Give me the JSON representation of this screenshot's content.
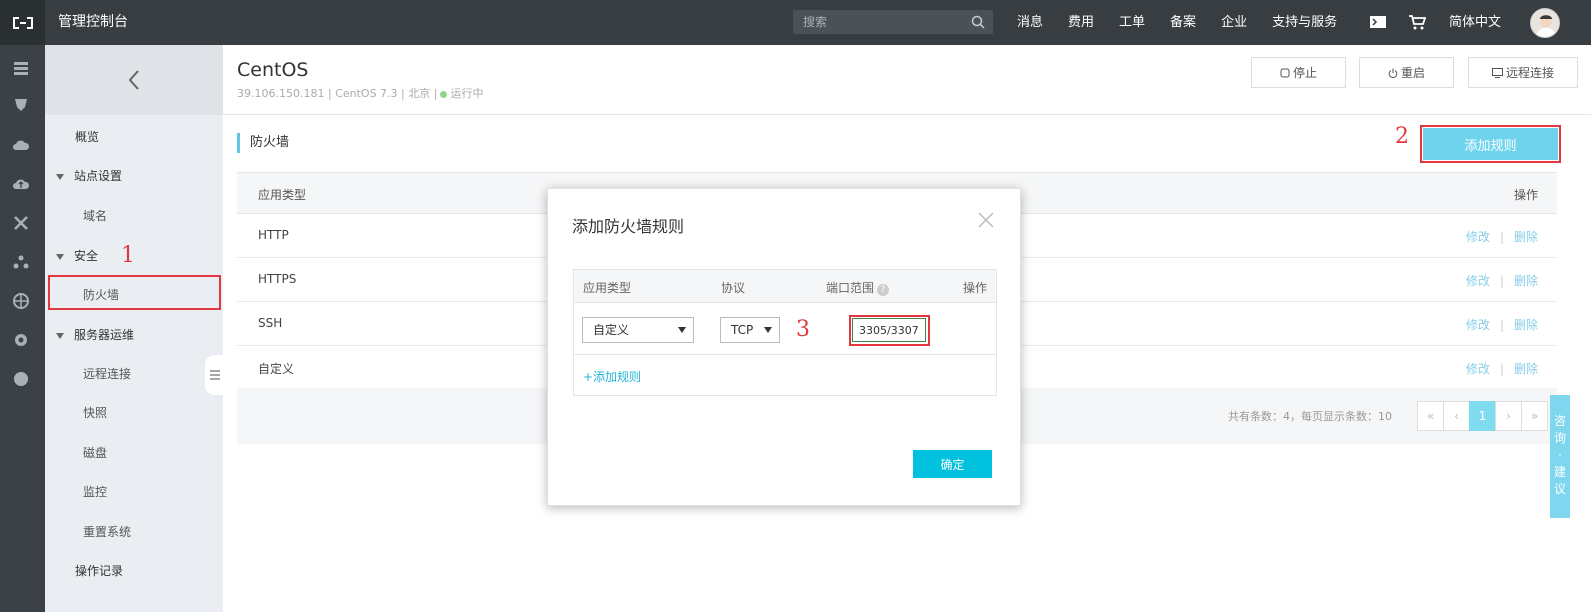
{
  "topbar": {
    "title": "管理控制台",
    "search_placeholder": "搜索",
    "nav": [
      "消息",
      "费用",
      "工单",
      "备案",
      "企业",
      "支持与服务"
    ],
    "lang": "简体中文"
  },
  "sidebar": {
    "items": [
      {
        "label": "概览"
      },
      {
        "label": "站点设置",
        "group": true
      },
      {
        "label": "域名"
      },
      {
        "label": "安全",
        "group": true
      },
      {
        "label": "防火墙",
        "active": true
      },
      {
        "label": "服务器运维",
        "group": true
      },
      {
        "label": "远程连接"
      },
      {
        "label": "快照"
      },
      {
        "label": "磁盘"
      },
      {
        "label": "监控"
      },
      {
        "label": "重置系统"
      },
      {
        "label": "操作记录"
      }
    ]
  },
  "instance": {
    "name": "CentOS",
    "meta": "39.106.150.181  |  CentOS 7.3  |  北京  |",
    "status": "运行中",
    "buttons": {
      "stop": "停止",
      "restart": "重启",
      "remote": "远程连接"
    }
  },
  "firewall": {
    "title": "防火墙",
    "add_rule": "添加规则",
    "columns": [
      "应用类型",
      "操作"
    ],
    "rows": [
      {
        "type": "HTTP",
        "edit": "修改",
        "delete": "删除"
      },
      {
        "type": "HTTPS",
        "edit": "修改",
        "delete": "删除"
      },
      {
        "type": "SSH",
        "edit": "修改",
        "delete": "删除"
      },
      {
        "type": "自定义",
        "edit": "修改",
        "delete": "删除"
      }
    ],
    "pagination": {
      "info": "共有条数：4，每页显示条数：10",
      "first": "«",
      "prev": "‹",
      "current": "1",
      "next": "›",
      "last": "»"
    }
  },
  "modal": {
    "title": "添加防火墙规则",
    "columns": [
      "应用类型",
      "协议",
      "端口范围",
      "操作"
    ],
    "row": {
      "app_type": "自定义",
      "protocol": "TCP",
      "port": "3305/3307"
    },
    "add_link": "+添加规则",
    "confirm": "确定"
  },
  "annotations": [
    "1",
    "2",
    "3"
  ],
  "feedback": [
    "咨",
    "询",
    "·",
    "建",
    "议"
  ],
  "colors": {
    "topbar": "#373d41",
    "accent": "#00c1de",
    "highlight": "#e0383e",
    "link": "#86cde9"
  }
}
